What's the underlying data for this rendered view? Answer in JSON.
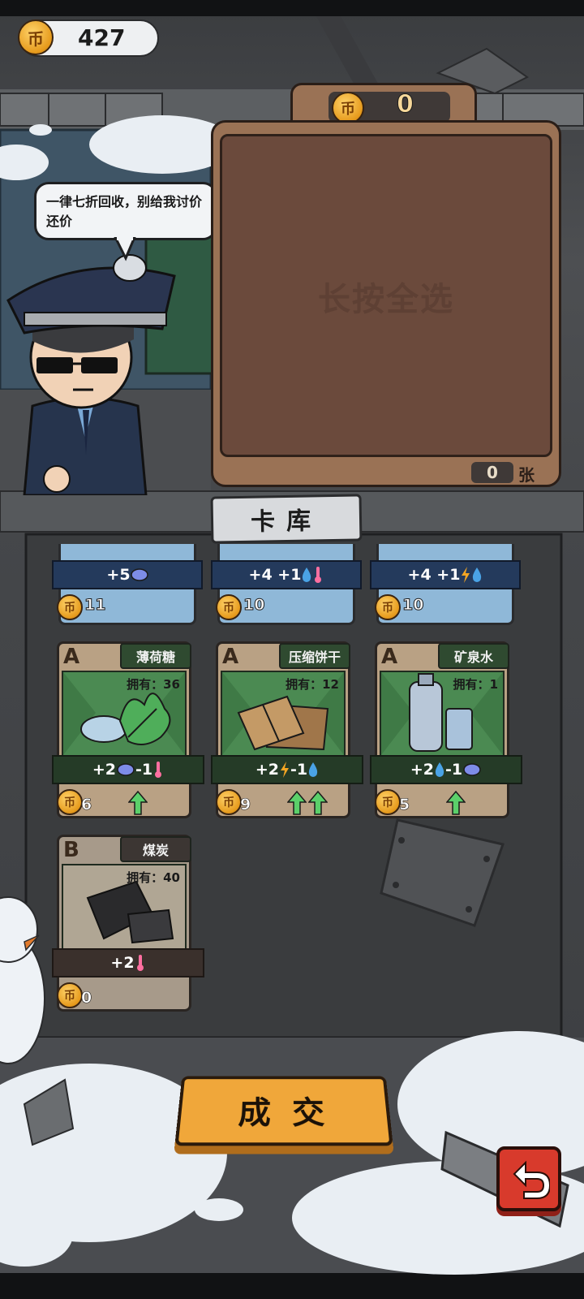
{
  "coins": "427",
  "sell_total": "0",
  "dialog": "一律七折回收，别给我讨价还价",
  "panel_hint": "长按全选",
  "selected_count": "0",
  "selected_unit": "张",
  "inventory_tab": "卡库",
  "deal_button": "成 交",
  "top_cards": [
    {
      "stats": "+5",
      "price": "11",
      "icons": [
        "brain"
      ]
    },
    {
      "stats": "+4 +1",
      "price": "10",
      "icons": [
        "water",
        "heat"
      ]
    },
    {
      "stats": "+4 +1",
      "price": "10",
      "icons": [
        "energy",
        "water"
      ]
    }
  ],
  "cards": [
    {
      "grade": "A",
      "name": "薄荷糖",
      "owned_label": "拥有：",
      "owned": "36",
      "stat_a": "+2",
      "stat_b": "-1",
      "icon_a": "brain",
      "icon_b": "heat",
      "price": "6",
      "arrows": 1
    },
    {
      "grade": "A",
      "name": "压缩饼干",
      "owned_label": "拥有：",
      "owned": "12",
      "stat_a": "+2",
      "stat_b": "-1",
      "icon_a": "energy",
      "icon_b": "water",
      "price": "9",
      "arrows": 2
    },
    {
      "grade": "A",
      "name": "矿泉水",
      "owned_label": "拥有：",
      "owned": "1",
      "stat_a": "+2",
      "stat_b": "-1",
      "icon_a": "water",
      "icon_b": "brain",
      "price": "5",
      "arrows": 1
    },
    {
      "grade": "B",
      "name": "煤炭",
      "owned_label": "拥有：",
      "owned": "40",
      "stat_a": "+2",
      "stat_b": "",
      "icon_a": "heat",
      "icon_b": "",
      "price": "0",
      "arrows": 0
    }
  ],
  "coin_glyph": "币",
  "colors": {
    "accent": "#f0a73a",
    "back_button": "#d83a2c",
    "panel": "#6b4a3c"
  }
}
